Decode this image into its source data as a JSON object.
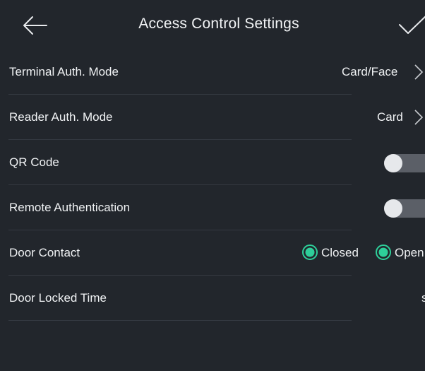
{
  "header": {
    "title": "Access Control Settings",
    "back_icon": "arrow-left-icon",
    "confirm_icon": "checkmark-icon"
  },
  "rows": [
    {
      "label": "Terminal Auth. Mode",
      "value": "Card/Face",
      "type": "select"
    },
    {
      "label": "Reader Auth. Mode",
      "value": "Card",
      "type": "select"
    },
    {
      "label": "QR Code",
      "type": "toggle",
      "enabled": false
    },
    {
      "label": "Remote Authentication",
      "type": "toggle",
      "enabled": false
    },
    {
      "label": "Door Contact",
      "type": "radio",
      "options": [
        "Closed",
        "Open"
      ],
      "selected": "Closed"
    },
    {
      "label": "Door Locked Time",
      "value": "s",
      "type": "value"
    }
  ],
  "colors": {
    "background": "#22262c",
    "accent": "#2ecf9a",
    "toggle_off": "#5b5f67",
    "text": "#f0f2f4"
  }
}
